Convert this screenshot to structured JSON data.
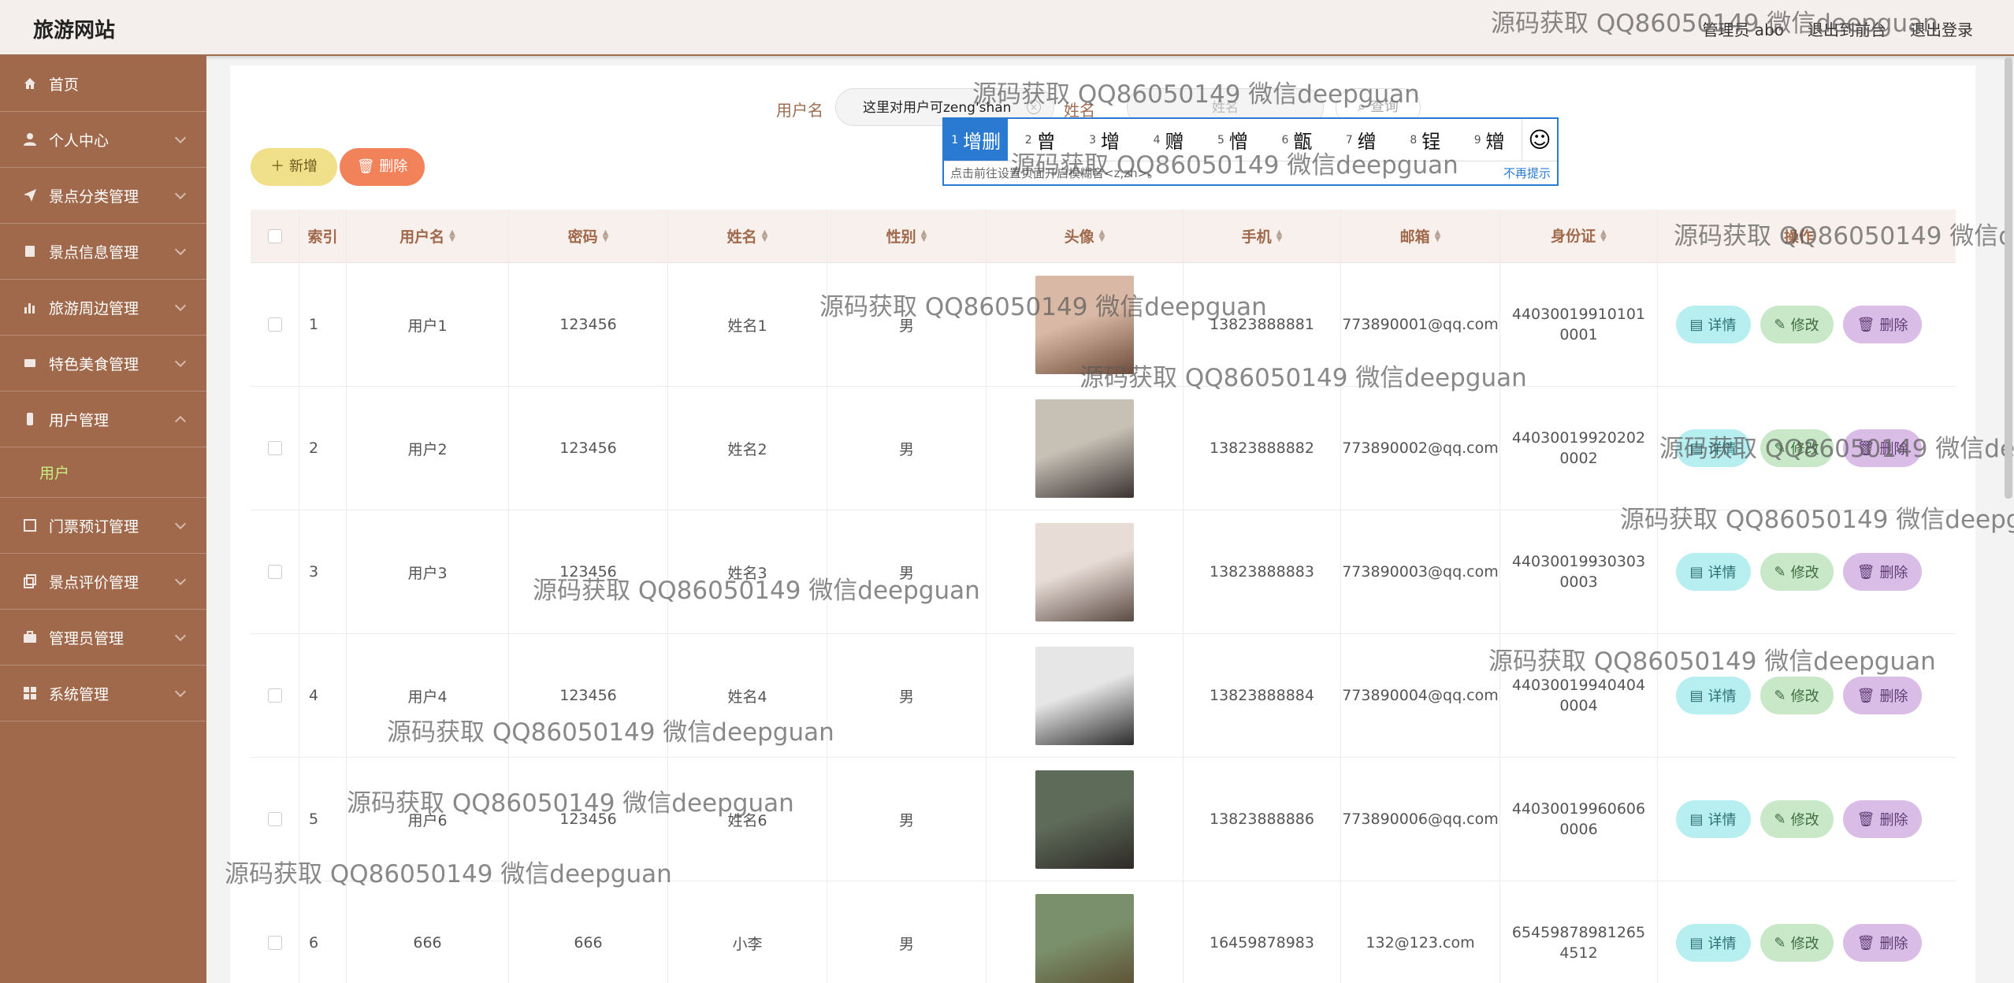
{
  "header": {
    "brand": "旅游网站",
    "admin_label": "管理员 abo",
    "back_label": "退出到前台",
    "logout_label": "退出登录"
  },
  "sidebar": {
    "items": [
      {
        "label": "首页",
        "icon": "home-icon"
      },
      {
        "label": "个人中心",
        "icon": "user-icon"
      },
      {
        "label": "景点分类管理",
        "icon": "send-icon"
      },
      {
        "label": "景点信息管理",
        "icon": "book-icon"
      },
      {
        "label": "旅游周边管理",
        "icon": "bar-chart-icon"
      },
      {
        "label": "特色美食管理",
        "icon": "coupon-icon"
      },
      {
        "label": "用户管理",
        "icon": "phone-icon"
      },
      {
        "label": "门票预订管理",
        "icon": "ticket-icon"
      },
      {
        "label": "景点评价管理",
        "icon": "copy-icon"
      },
      {
        "label": "管理员管理",
        "icon": "briefcase-icon"
      },
      {
        "label": "系统管理",
        "icon": "grid-icon"
      }
    ],
    "active_submenu": "用户"
  },
  "search": {
    "username_label": "用户名",
    "username_value": "这里对用户可zeng'shan",
    "name_label": "姓名",
    "name_placeholder": "姓名",
    "query_label": "查询"
  },
  "ime": {
    "candidates": [
      {
        "n": "1",
        "ch": "增删"
      },
      {
        "n": "2",
        "ch": "曾"
      },
      {
        "n": "3",
        "ch": "增"
      },
      {
        "n": "4",
        "ch": "赠"
      },
      {
        "n": "5",
        "ch": "憎"
      },
      {
        "n": "6",
        "ch": "甑"
      },
      {
        "n": "7",
        "ch": "缯"
      },
      {
        "n": "8",
        "ch": "锃"
      },
      {
        "n": "9",
        "ch": "矰"
      }
    ],
    "hint": "点击前往设置页面开启模糊音<z,zh>。",
    "dismiss": "不再提示"
  },
  "actions": {
    "add_label": "新增",
    "delete_label": "删除"
  },
  "table": {
    "headers": {
      "index": "索引",
      "username": "用户名",
      "password": "密码",
      "name": "姓名",
      "sex": "性别",
      "avatar": "头像",
      "phone": "手机",
      "email": "邮箱",
      "idcard": "身份证",
      "ops": "操作"
    },
    "op_labels": {
      "detail": "详情",
      "edit": "修改",
      "remove": "删除"
    },
    "rows": [
      {
        "index": "1",
        "username": "用户1",
        "password": "123456",
        "name": "姓名1",
        "sex": "男",
        "phone": "13823888881",
        "email": "773890001@qq.com",
        "idcard": "440300199101010001"
      },
      {
        "index": "2",
        "username": "用户2",
        "password": "123456",
        "name": "姓名2",
        "sex": "男",
        "phone": "13823888882",
        "email": "773890002@qq.com",
        "idcard": "440300199202020002"
      },
      {
        "index": "3",
        "username": "用户3",
        "password": "123456",
        "name": "姓名3",
        "sex": "男",
        "phone": "13823888883",
        "email": "773890003@qq.com",
        "idcard": "440300199303030003"
      },
      {
        "index": "4",
        "username": "用户4",
        "password": "123456",
        "name": "姓名4",
        "sex": "男",
        "phone": "13823888884",
        "email": "773890004@qq.com",
        "idcard": "440300199404040004"
      },
      {
        "index": "5",
        "username": "用户6",
        "password": "123456",
        "name": "姓名6",
        "sex": "男",
        "phone": "13823888886",
        "email": "773890006@qq.com",
        "idcard": "440300199606060006"
      },
      {
        "index": "6",
        "username": "666",
        "password": "666",
        "name": "小李",
        "sex": "男",
        "phone": "16459878983",
        "email": "132@123.com",
        "idcard": "654598789812654512"
      }
    ]
  },
  "watermark": "源码获取 QQ86050149 微信deepguan",
  "colors": {
    "sidebar": "#a0694b",
    "accent_green": "#c7f07f",
    "ime_blue": "#2a7ad2"
  }
}
